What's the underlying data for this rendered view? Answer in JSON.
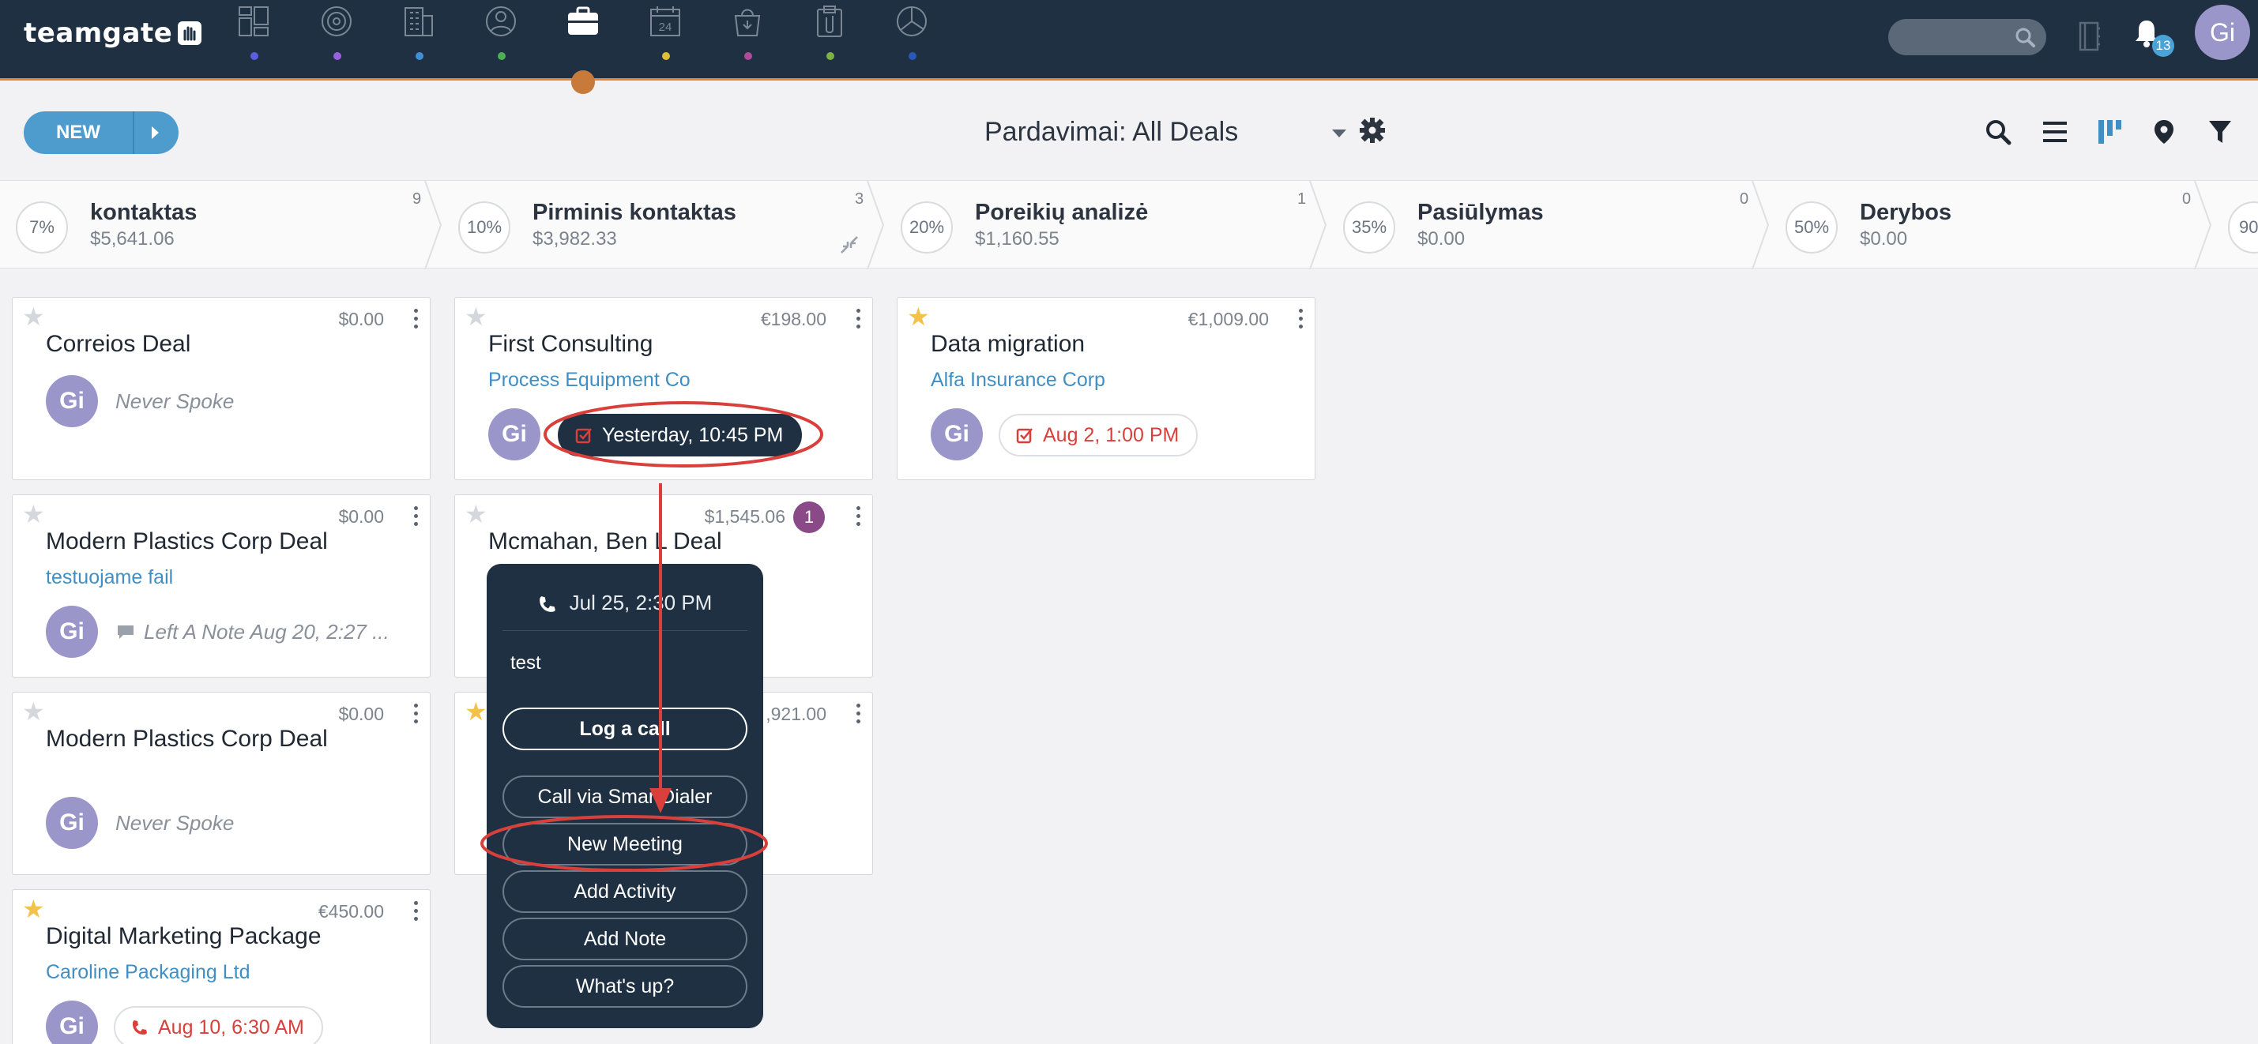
{
  "app": {
    "logo_text": "teamgate",
    "colors": {
      "nav_bg": "#1e3042",
      "accent_orange": "#e3873f",
      "link_blue": "#3f8fc5",
      "avatar": "#9b96c9",
      "annotation_red": "#d9403b"
    }
  },
  "topnav": {
    "items": [
      {
        "icon": "dashboard-icon",
        "dot_color": "#5b5ee0"
      },
      {
        "icon": "target-icon",
        "dot_color": "#9a5fe0"
      },
      {
        "icon": "building-icon",
        "dot_color": "#3f8fd8"
      },
      {
        "icon": "person-icon",
        "dot_color": "#4caf50"
      },
      {
        "icon": "briefcase-icon",
        "dot_color": "#e3873f",
        "active": true
      },
      {
        "icon": "calendar-icon",
        "dot_color": "#e0c030",
        "label": "24"
      },
      {
        "icon": "shopping-bag-icon",
        "dot_color": "#b04a9a"
      },
      {
        "icon": "clipboard-icon",
        "dot_color": "#7cb342"
      },
      {
        "icon": "pie-chart-icon",
        "dot_color": "#2a58b8"
      }
    ],
    "notifications_count": "13",
    "user_initials": "Gi"
  },
  "toolbar": {
    "new_label": "NEW",
    "pipeline_title": "Pardavimai: All Deals"
  },
  "stages": [
    {
      "pct": "7%",
      "name": "kontaktas",
      "amount": "$5,641.06",
      "count": "9"
    },
    {
      "pct": "10%",
      "name": "Pirminis kontaktas",
      "amount": "$3,982.33",
      "count": "3"
    },
    {
      "pct": "20%",
      "name": "Poreikių analizė",
      "amount": "$1,160.55",
      "count": "1"
    },
    {
      "pct": "35%",
      "name": "Pasiūlymas",
      "amount": "$0.00",
      "count": "0"
    },
    {
      "pct": "50%",
      "name": "Derybos",
      "amount": "$0.00",
      "count": "0"
    },
    {
      "pct": "90"
    }
  ],
  "cards": {
    "c1": {
      "amount": "$0.00",
      "title": "Correios Deal",
      "avatar": "Gi",
      "status": "Never Spoke"
    },
    "c2": {
      "amount": "$0.00",
      "title": "Modern Plastics Corp Deal",
      "company": "testuojame fail",
      "avatar": "Gi",
      "status": "Left A Note Aug 20, 2:27 ..."
    },
    "c3": {
      "amount": "$0.00",
      "title": "Modern Plastics Corp Deal",
      "avatar": "Gi",
      "status": "Never Spoke"
    },
    "c4": {
      "amount": "€450.00",
      "title": "Digital Marketing Package",
      "company": "Caroline Packaging Ltd",
      "avatar": "Gi",
      "activity": "Aug 10, 6:30 AM",
      "starred": true
    },
    "c5": {
      "amount": "€198.00",
      "title": "First Consulting",
      "company": "Process Equipment Co",
      "avatar": "Gi",
      "activity": "Yesterday, 10:45 PM"
    },
    "c6": {
      "amount": "$1,545.06",
      "title": "Mcmahan, Ben L Deal",
      "badge": "1"
    },
    "c7": {
      "amount": "$4,921.00",
      "amount_visible": ",921.00",
      "starred": true
    },
    "c8": {
      "amount": "€1,009.00",
      "title": "Data migration",
      "company": "Alfa Insurance Corp",
      "avatar": "Gi",
      "activity": "Aug 2, 1:00 PM",
      "starred": true
    }
  },
  "popup": {
    "time": "Jul 25, 2:30 PM",
    "note": "test",
    "log_call": "Log a call",
    "call_smartdialer": "Call via SmartDialer",
    "new_meeting": "New Meeting",
    "add_activity": "Add Activity",
    "add_note": "Add Note",
    "whats_up": "What's up?"
  }
}
